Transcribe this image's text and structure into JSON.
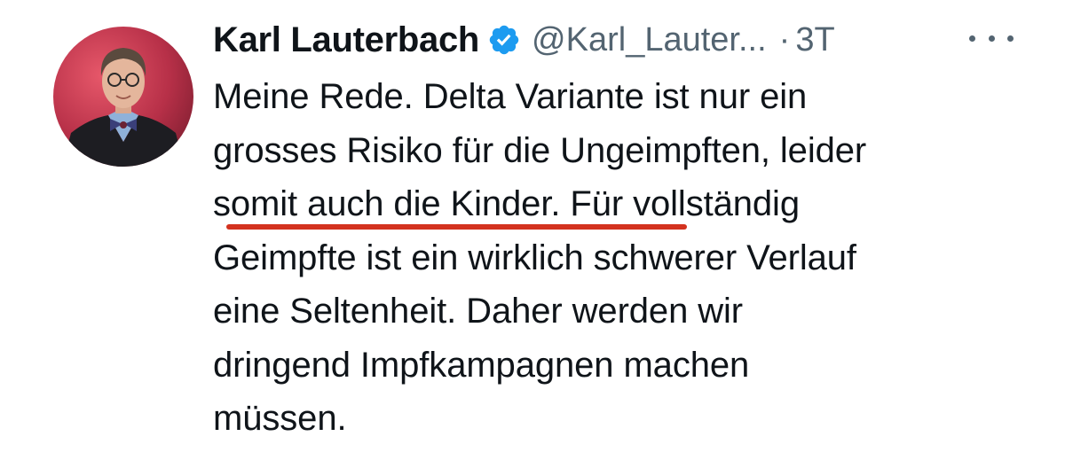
{
  "tweet": {
    "author": {
      "display_name": "Karl Lauterbach",
      "handle": "@Karl_Lauter...",
      "verified_icon": "verified-badge-icon"
    },
    "separator": "·",
    "timestamp": "3T",
    "more_icon": "more-horizontal-icon",
    "text_lines": [
      "Meine Rede. Delta Variante ist nur ein",
      "grosses Risiko für die Ungeimpften, leider",
      "somit auch die Kinder. Für vollständig",
      "Geimpfte ist ein wirklich schwerer Verlauf",
      "eine Seltenheit. Daher werden wir",
      "dringend Impfkampagnen machen",
      "müssen."
    ]
  },
  "colors": {
    "text": "#0f1419",
    "secondary": "#536471",
    "verified": "#1d9bf0",
    "underline_annotation": "#d3321f"
  }
}
